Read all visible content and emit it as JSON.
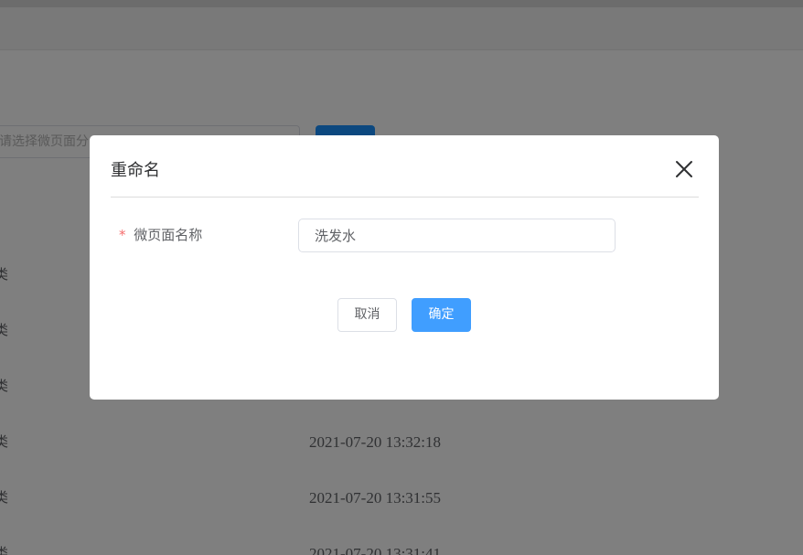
{
  "background": {
    "search_placeholder": "请选择微页面分",
    "row_category_fragment": "类",
    "rows": [
      {
        "category": "类",
        "time": ""
      },
      {
        "category": "类",
        "time": ""
      },
      {
        "category": "类",
        "time": ""
      },
      {
        "category": "类",
        "time": "2021-07-20 13:32:18"
      },
      {
        "category": "类",
        "time": "2021-07-20 13:31:55"
      },
      {
        "category": "类",
        "time": "2021-07-20 13:31:41"
      }
    ]
  },
  "dialog": {
    "title": "重命名",
    "field_required_mark": "*",
    "field_label": "微页面名称",
    "field_value": "洗发水",
    "cancel_label": "取消",
    "confirm_label": "确定"
  },
  "colors": {
    "primary": "#409eff",
    "required": "#f56c6c",
    "overlay": "rgba(0,0,0,0.5)"
  },
  "icons": {
    "close": "close-icon"
  }
}
